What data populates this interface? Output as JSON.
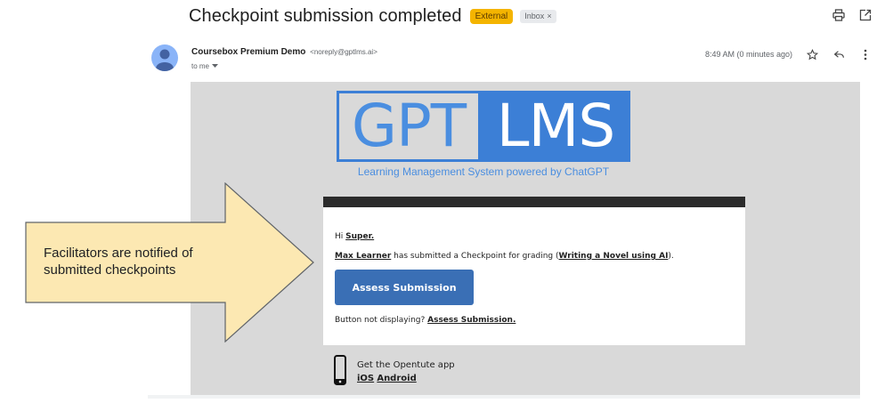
{
  "header": {
    "subject": "Checkpoint submission completed",
    "badge_external": "External",
    "badge_inbox": "Inbox",
    "badge_inbox_close": "×"
  },
  "top_icons": [
    "print-icon",
    "open-in-new-window-icon"
  ],
  "sender": {
    "name": "Coursebox Premium Demo",
    "email": "<noreply@gptlms.ai>",
    "to": "to me",
    "time": "8:49 AM (0 minutes ago)"
  },
  "message_actions": [
    "star-icon",
    "reply-icon",
    "more-vert-icon"
  ],
  "logo": {
    "part1": "GPT",
    "part2": "LMS",
    "tagline": "Learning Management System powered by ChatGPT",
    "colors": {
      "blue": "#3c7fd6",
      "text_blue": "#4a8ee0"
    }
  },
  "card": {
    "greeting_prefix": "Hi ",
    "greeting_name": "Super.",
    "learner": "Max Learner",
    "msg_middle": " has submitted a Checkpoint for grading (",
    "course": "Writing a Novel using AI",
    "msg_end": ").",
    "button_label": "Assess Submission",
    "not_displaying_prefix": "Button not displaying? ",
    "not_displaying_link": "Assess Submission."
  },
  "app_promo": {
    "title": "Get the Opentute app",
    "ios": "iOS",
    "android": "Android"
  },
  "callout": {
    "text": "Facilitators are notified of submitted checkpoints",
    "fill": "#fce8b2",
    "stroke": "#5f6368"
  }
}
